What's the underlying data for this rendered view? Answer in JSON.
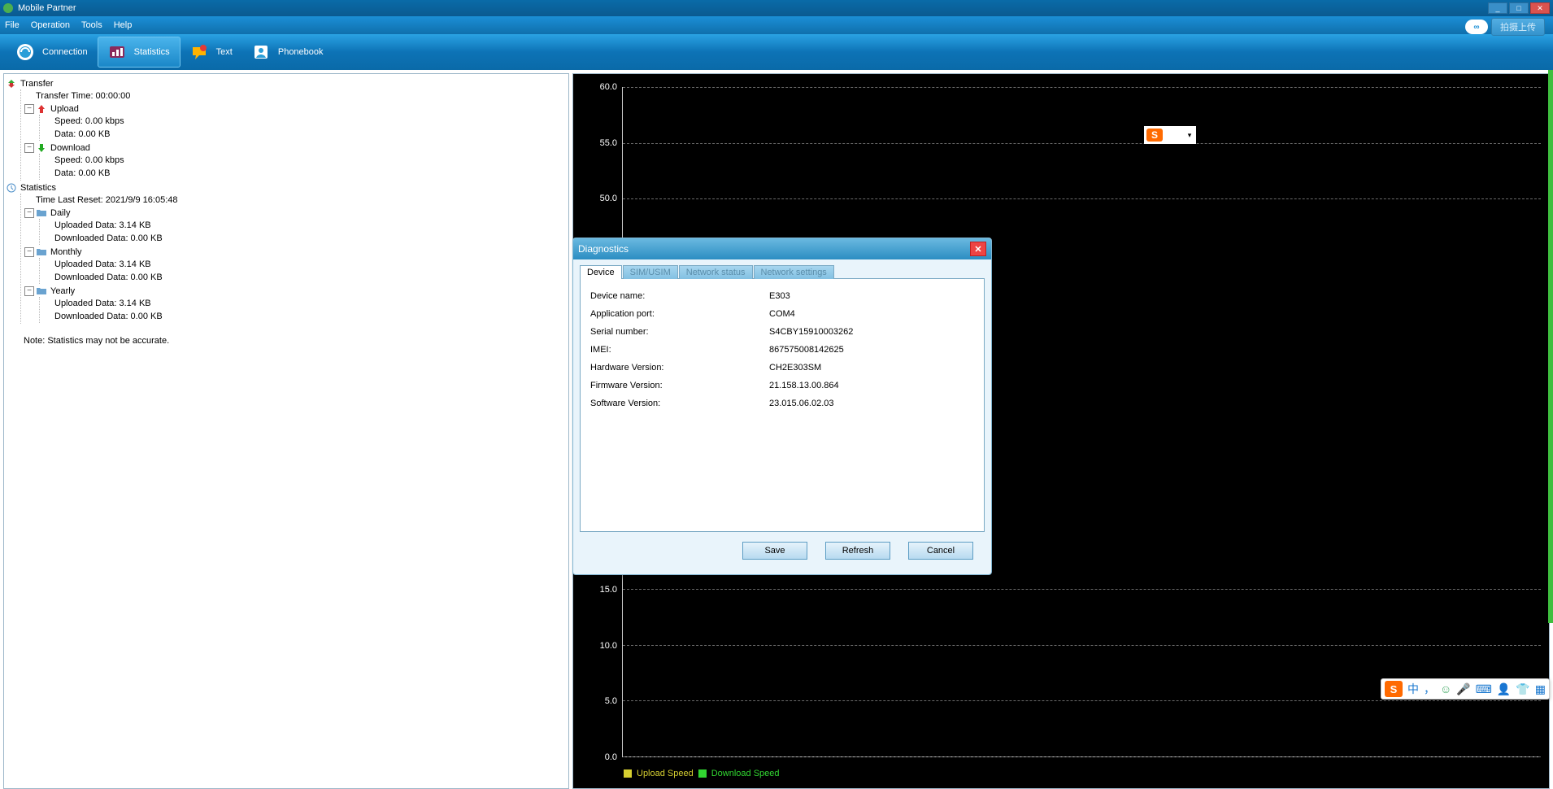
{
  "app": {
    "title": "Mobile Partner"
  },
  "window_controls": {
    "min": "_",
    "max": "□",
    "close": "✕"
  },
  "menu": {
    "file": "File",
    "operation": "Operation",
    "tools": "Tools",
    "help": "Help"
  },
  "upload_plugin": {
    "icon_text": "∞",
    "label": "拍摄上传"
  },
  "toolbar": {
    "connection": "Connection",
    "statistics": "Statistics",
    "text": "Text",
    "phonebook": "Phonebook"
  },
  "tree": {
    "transfer": "Transfer",
    "transfer_time": "Transfer Time: 00:00:00",
    "upload": "Upload",
    "upload_speed": "Speed: 0.00 kbps",
    "upload_data": "Data: 0.00 KB",
    "download": "Download",
    "download_speed": "Speed: 0.00 kbps",
    "download_data": "Data: 0.00 KB",
    "statistics": "Statistics",
    "time_last_reset": "Time Last Reset: 2021/9/9 16:05:48",
    "daily": "Daily",
    "daily_up": "Uploaded Data: 3.14 KB",
    "daily_down": "Downloaded Data: 0.00 KB",
    "monthly": "Monthly",
    "monthly_up": "Uploaded Data: 3.14 KB",
    "monthly_down": "Downloaded Data: 0.00 KB",
    "yearly": "Yearly",
    "yearly_up": "Uploaded Data: 3.14 KB",
    "yearly_down": "Downloaded Data: 0.00 KB",
    "note": "Note: Statistics may not be accurate."
  },
  "chart_data": {
    "type": "line",
    "title": "",
    "xlabel": "",
    "ylabel": "",
    "ylim": [
      0,
      60
    ],
    "y_ticks": [
      60.0,
      55.0,
      50.0,
      15.0,
      10.0,
      5.0,
      0.0
    ],
    "series": [
      {
        "name": "Upload Speed",
        "color": "#d6cf31",
        "values": []
      },
      {
        "name": "Download Speed",
        "color": "#31d631",
        "values": []
      }
    ],
    "legend_position": "bottom-left",
    "grid": true
  },
  "legend": {
    "upload": "Upload Speed",
    "download": "Download Speed"
  },
  "dialog": {
    "title": "Diagnostics",
    "tabs": {
      "device": "Device",
      "sim": "SIM/USIM",
      "network_status": "Network status",
      "network_settings": "Network settings"
    },
    "fields": {
      "device_name_k": "Device name:",
      "device_name_v": "E303",
      "app_port_k": "Application port:",
      "app_port_v": "COM4",
      "serial_k": "Serial number:",
      "serial_v": "S4CBY15910003262",
      "imei_k": "IMEI:",
      "imei_v": "867575008142625",
      "hw_k": "Hardware Version:",
      "hw_v": "CH2E303SM",
      "fw_k": "Firmware Version:",
      "fw_v": "21.158.13.00.864",
      "sw_k": "Software Version:",
      "sw_v": "23.015.06.02.03"
    },
    "buttons": {
      "save": "Save",
      "refresh": "Refresh",
      "cancel": "Cancel"
    }
  },
  "ime": {
    "s": "S",
    "lang": "中",
    "comma": "，",
    "smile": "☺",
    "mic": "🎤",
    "kb": "⌨",
    "person": "👤",
    "shirt": "👕",
    "grid": "▦"
  },
  "colors": {
    "accent": "#0f79bd",
    "upload": "#d6cf31",
    "download": "#31d631"
  }
}
